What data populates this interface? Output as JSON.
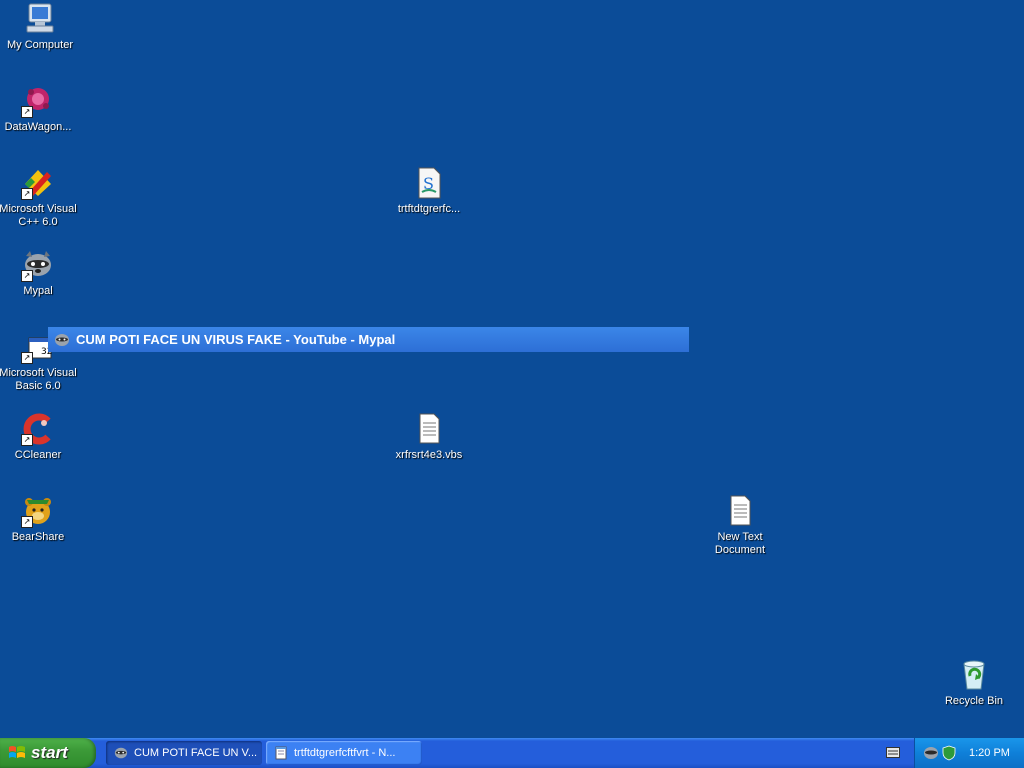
{
  "desktop_icons": [
    {
      "label": "My Computer"
    },
    {
      "label": "DataWagon..."
    },
    {
      "label": "Microsoft Visual C++ 6.0"
    },
    {
      "label": "Mypal"
    },
    {
      "label": "Microsoft Visual Basic 6.0"
    },
    {
      "label": "CCleaner"
    },
    {
      "label": "BearShare"
    },
    {
      "label": "trtftdtgrerfc..."
    },
    {
      "label": "xrfrsrt4e3.vbs"
    },
    {
      "label": "New Text Document"
    },
    {
      "label": "Recycle Bin"
    }
  ],
  "drag_window": {
    "title": "CUM POTI FACE UN VIRUS FAKE - YouTube - Mypal"
  },
  "taskbar": {
    "start_label": "start",
    "buttons": [
      {
        "label": "CUM POTI FACE UN V...",
        "active": true
      },
      {
        "label": "trtftdtgrerfcftfvrt - N...",
        "active": false
      }
    ],
    "clock": "1:20 PM"
  },
  "colors": {
    "desktop": "#0b4c98",
    "taskbar": "#245edb",
    "start": "#3c9a38",
    "tray": "#0f80d9"
  }
}
